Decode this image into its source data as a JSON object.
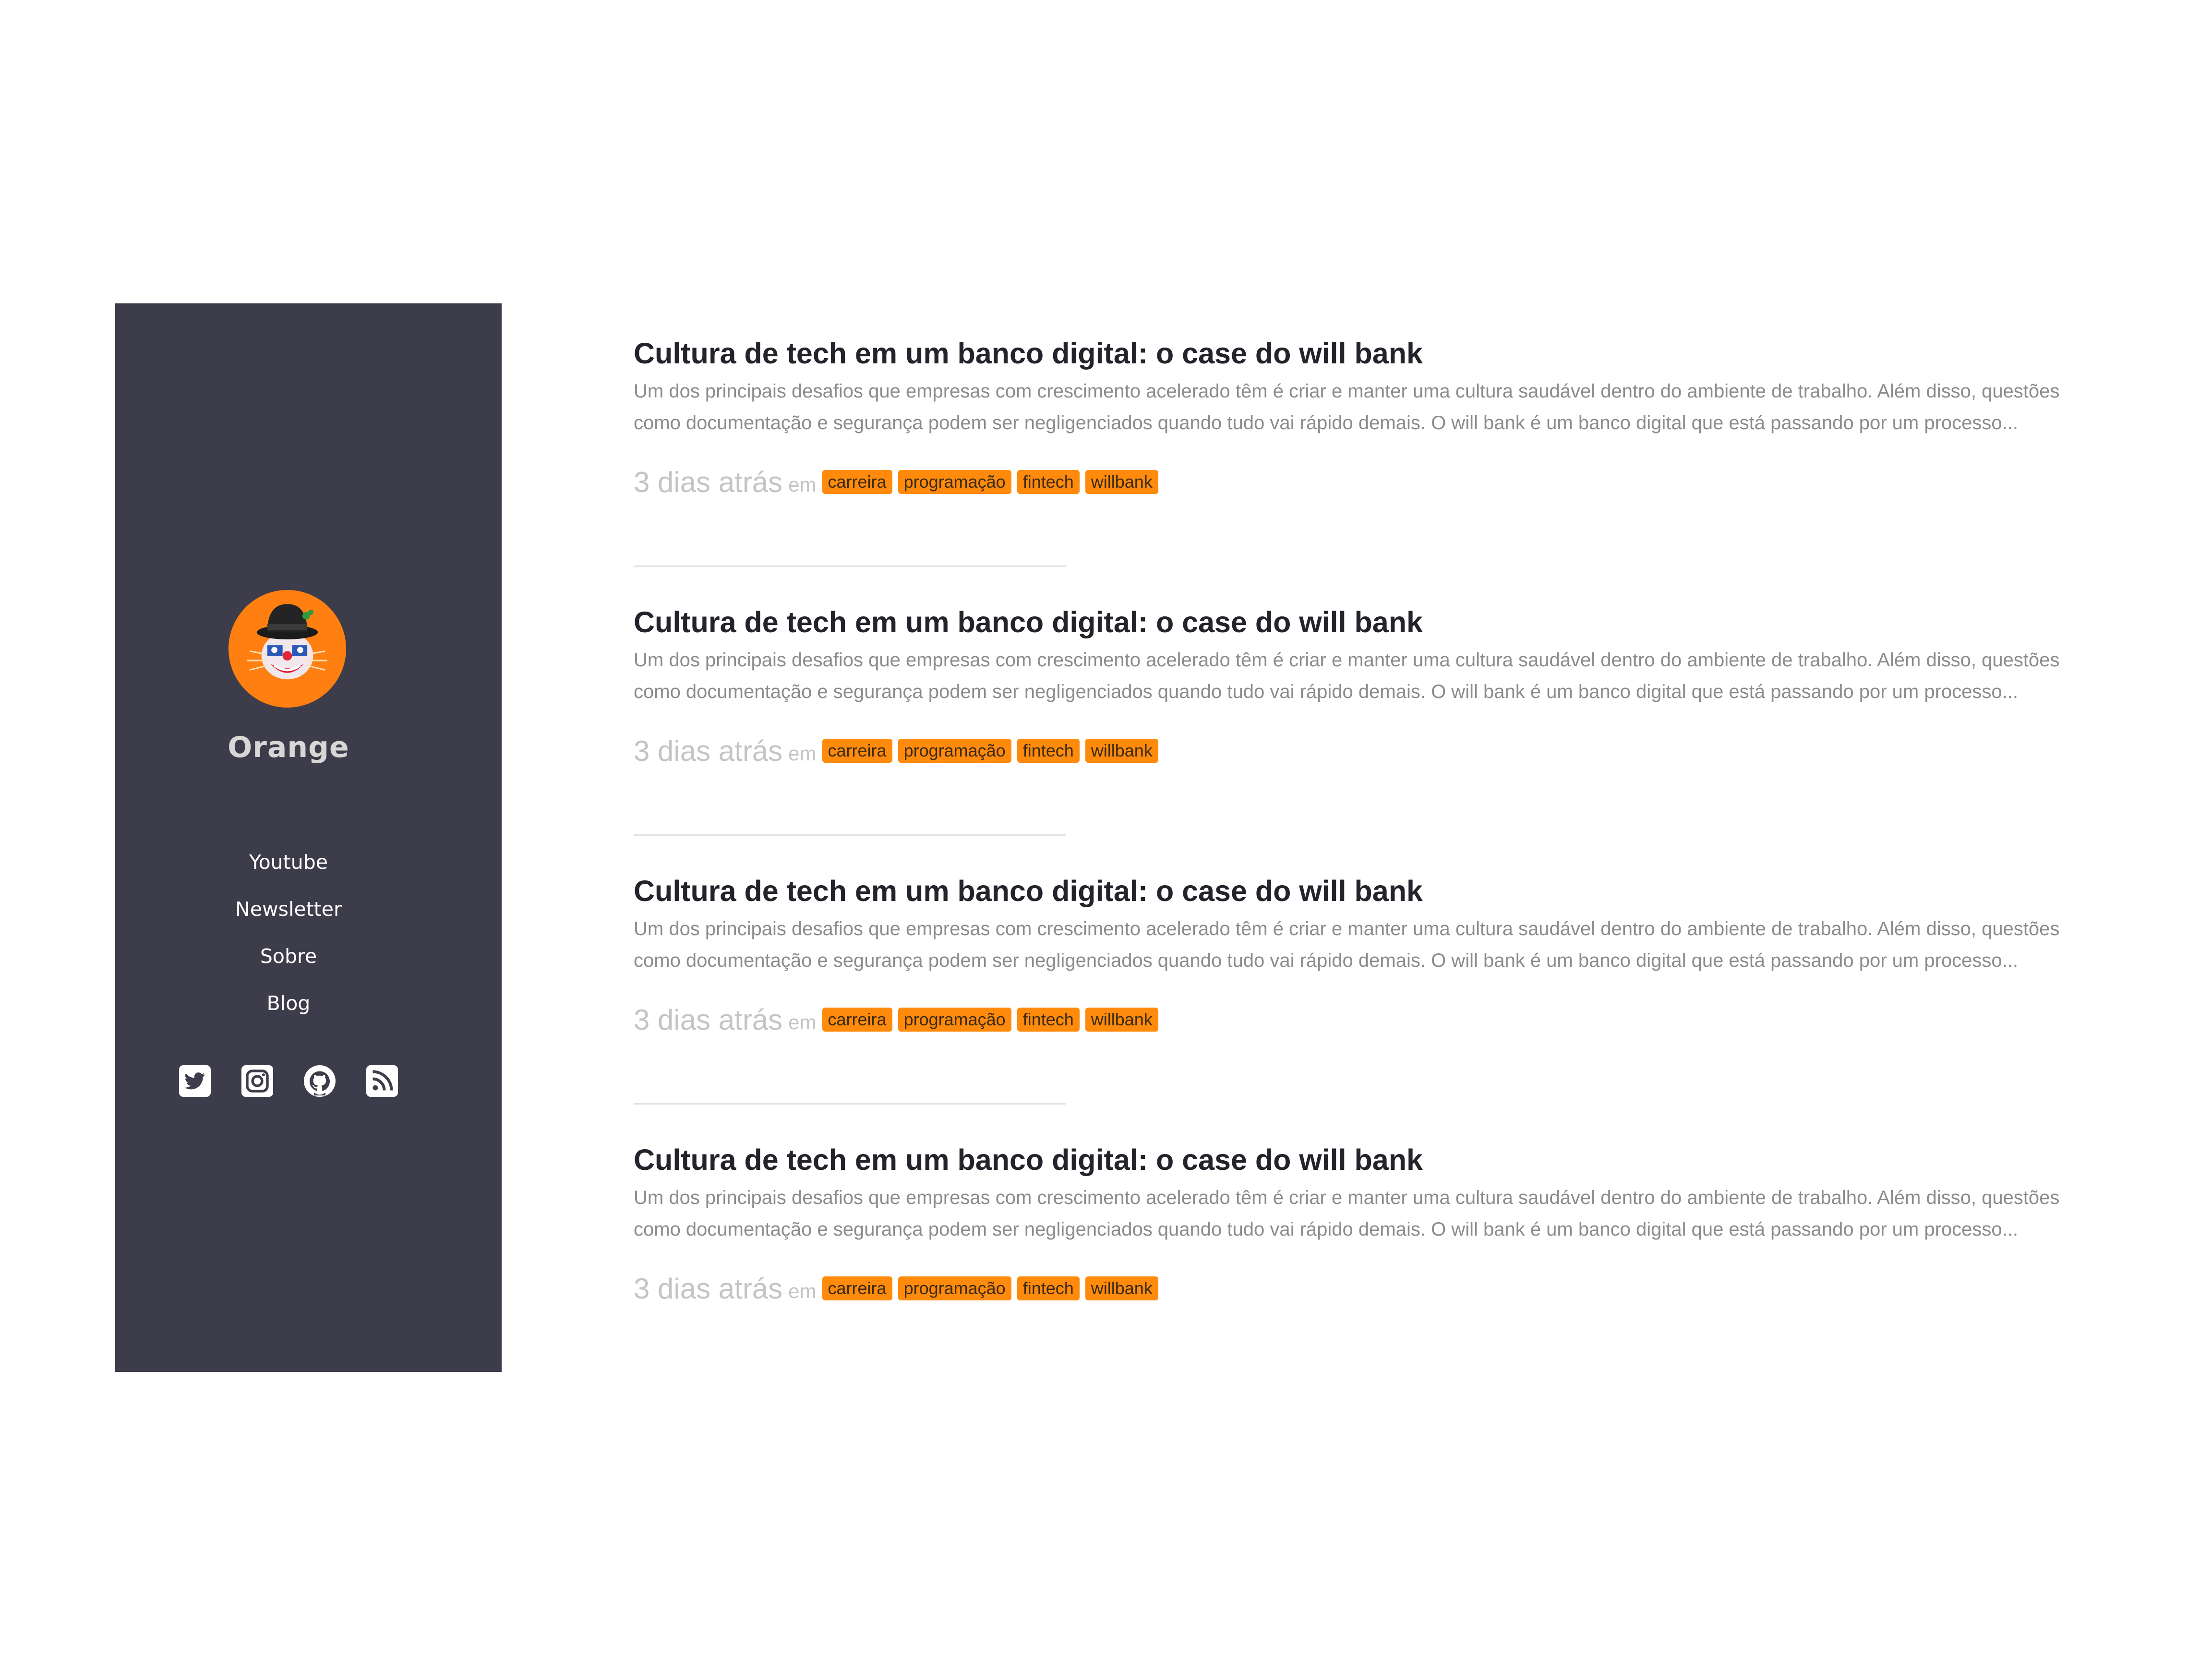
{
  "sidebar": {
    "profile_name": "Orange",
    "avatar_icon": "clown-avatar-icon",
    "nav": [
      {
        "label": "Youtube"
      },
      {
        "label": "Newsletter"
      },
      {
        "label": "Sobre"
      },
      {
        "label": "Blog"
      }
    ],
    "social": [
      {
        "name": "twitter-icon"
      },
      {
        "name": "instagram-icon"
      },
      {
        "name": "github-icon"
      },
      {
        "name": "rss-icon"
      }
    ]
  },
  "colors": {
    "sidebar_bg": "#3d3c4a",
    "accent": "#ff8a0b",
    "title": "#23232b",
    "excerpt": "#8b8b8b",
    "meta": "#c4c4c4"
  },
  "posts": [
    {
      "title": "Cultura de tech em um banco digital: o case do will bank",
      "excerpt": "Um dos principais desafios que empresas com crescimento acelerado têm é criar e manter uma cultura saudável dentro do ambiente de trabalho. Além disso, questões como documentação e segurança podem ser negligenciados quando tudo vai rápido demais. O will bank é um banco digital que está passando por um processo...",
      "date": "3 dias atrás",
      "in": "em",
      "tags": [
        "carreira",
        "programação",
        "fintech",
        "willbank"
      ]
    },
    {
      "title": "Cultura de tech em um banco digital: o case do will bank",
      "excerpt": "Um dos principais desafios que empresas com crescimento acelerado têm é criar e manter uma cultura saudável dentro do ambiente de trabalho. Além disso, questões como documentação e segurança podem ser negligenciados quando tudo vai rápido demais. O will bank é um banco digital que está passando por um processo...",
      "date": "3 dias atrás",
      "in": "em",
      "tags": [
        "carreira",
        "programação",
        "fintech",
        "willbank"
      ]
    },
    {
      "title": "Cultura de tech em um banco digital: o case do will bank",
      "excerpt": "Um dos principais desafios que empresas com crescimento acelerado têm é criar e manter uma cultura saudável dentro do ambiente de trabalho. Além disso, questões como documentação e segurança podem ser negligenciados quando tudo vai rápido demais. O will bank é um banco digital que está passando por um processo...",
      "date": "3 dias atrás",
      "in": "em",
      "tags": [
        "carreira",
        "programação",
        "fintech",
        "willbank"
      ]
    },
    {
      "title": "Cultura de tech em um banco digital: o case do will bank",
      "excerpt": "Um dos principais desafios que empresas com crescimento acelerado têm é criar e manter uma cultura saudável dentro do ambiente de trabalho. Além disso, questões como documentação e segurança podem ser negligenciados quando tudo vai rápido demais. O will bank é um banco digital que está passando por um processo...",
      "date": "3 dias atrás",
      "in": "em",
      "tags": [
        "carreira",
        "programação",
        "fintech",
        "willbank"
      ]
    }
  ]
}
